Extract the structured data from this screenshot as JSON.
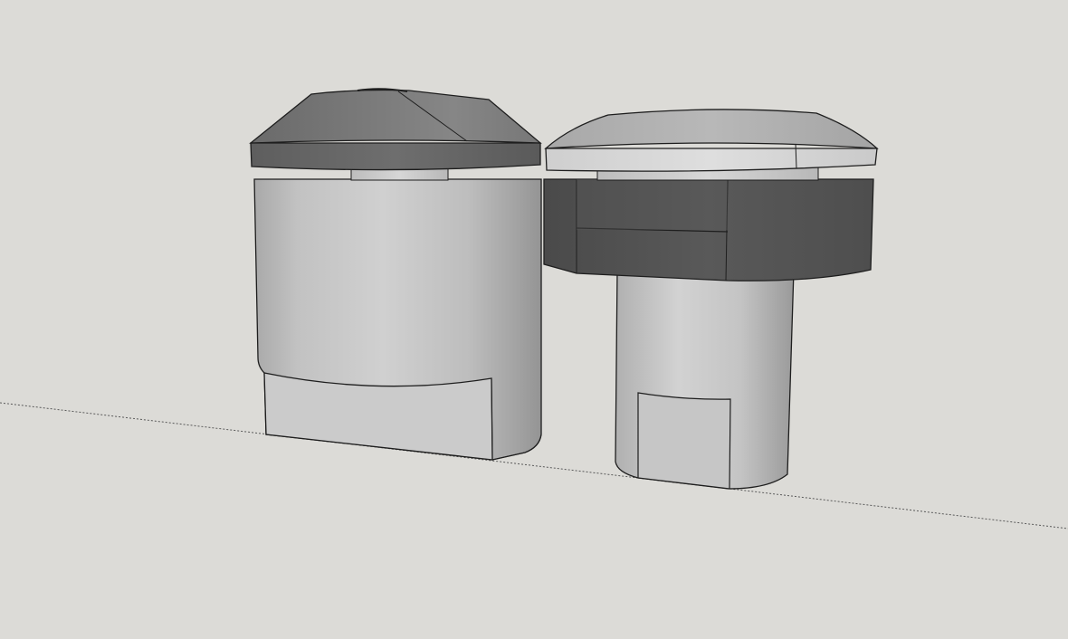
{
  "app": {
    "mode": "3d-modeling-viewport"
  },
  "scene": {
    "background_color": "#dcdbd7",
    "ground_axis_color": "#5a5a5a",
    "edge_color": "#1e1e1e",
    "models": [
      {
        "id": "left-knob",
        "parts": [
          "conical-cap",
          "neck",
          "cylinder-body",
          "front-flat-cut"
        ]
      },
      {
        "id": "right-knob",
        "parts": [
          "dome-cap",
          "neck",
          "octagonal-collar",
          "cylinder-shaft",
          "front-flat-cut"
        ]
      }
    ]
  }
}
